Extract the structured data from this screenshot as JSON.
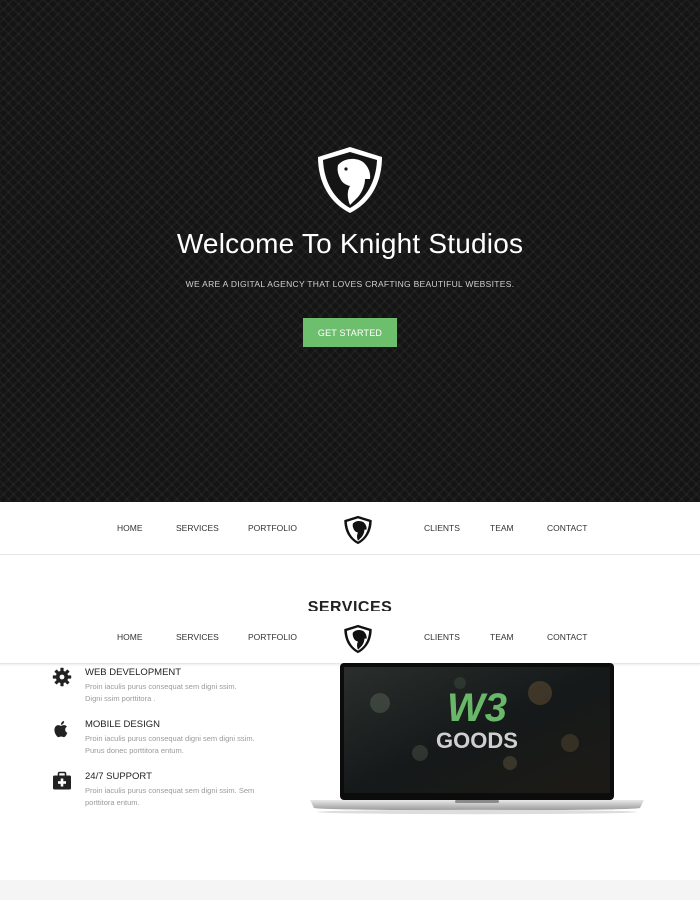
{
  "hero": {
    "title": "Welcome To Knight Studios",
    "subtitle": "WE ARE A DIGITAL AGENCY THAT LOVES CRAFTING BEAUTIFUL WEBSITES.",
    "cta_label": "GET STARTED",
    "logo_icon": "knight-horse-shield-icon"
  },
  "nav": {
    "items_left": [
      "HOME",
      "SERVICES",
      "PORTFOLIO"
    ],
    "items_right": [
      "CLIENTS",
      "TEAM",
      "CONTACT"
    ],
    "logo_icon": "knight-horse-shield-icon"
  },
  "services": {
    "heading": "SERVICES",
    "items": [
      {
        "title": "WEB DEVELOPMENT",
        "desc": "Proin iaculis purus consequat sem digni ssim. Digni ssim porttitora .",
        "icon": "gear-icon"
      },
      {
        "title": "MOBILE DESIGN",
        "desc": "Proin iaculis purus consequat digni sem digni ssim. Purus donec porttitora entum.",
        "icon": "apple-icon"
      },
      {
        "title": "24/7 SUPPORT",
        "desc": "Proin iaculis purus consequat sem digni ssim. Sem porttitora entum.",
        "icon": "first-aid-kit-icon"
      }
    ]
  },
  "laptop": {
    "screen_brand_top": "W3",
    "screen_brand_bottom": "GOODS",
    "icon": "laptop-icon"
  },
  "colors": {
    "hero_bg": "#141414",
    "accent_green": "#6dbf6d",
    "text_dark": "#222222",
    "text_muted": "#9a9a9a"
  }
}
